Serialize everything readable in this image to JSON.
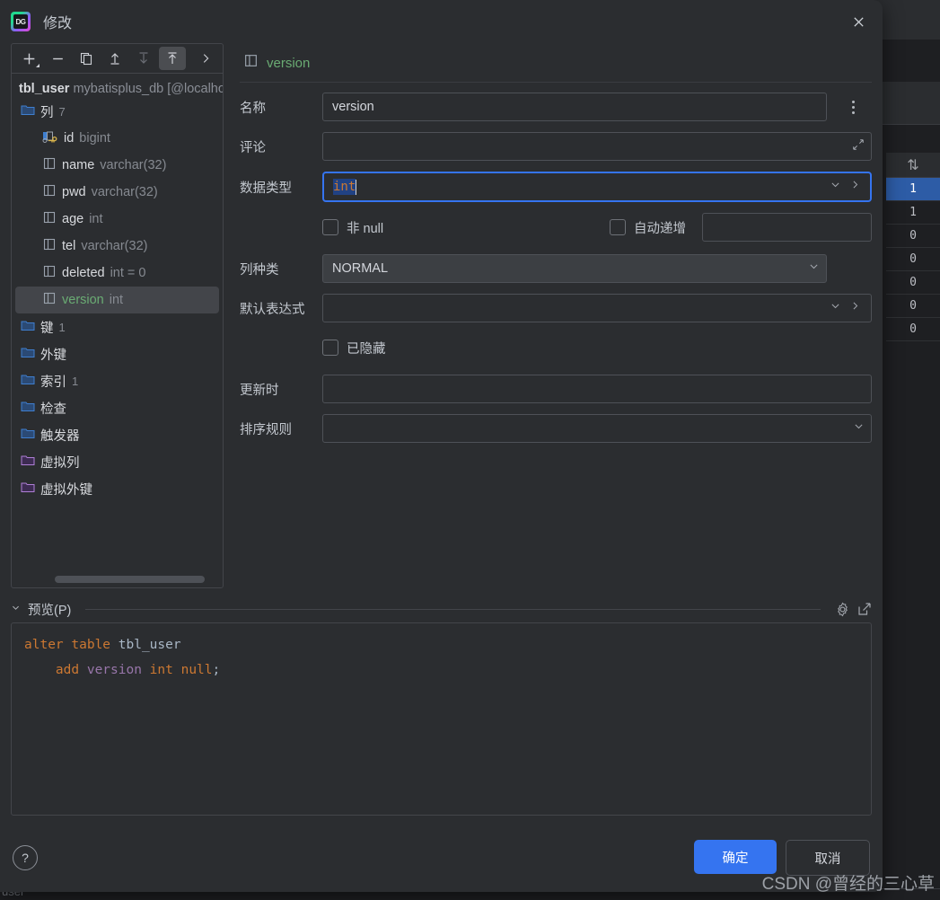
{
  "window": {
    "app_icon": "datagrip-logo-icon",
    "title": "修改",
    "close_icon": "close-icon"
  },
  "background": {
    "grid_header_icon": "sort-icon",
    "grid_values": [
      "1",
      "1",
      "0",
      "0",
      "0",
      "0",
      "0"
    ],
    "bottom_text": "user"
  },
  "tree": {
    "toolbar": [
      {
        "name": "add-button",
        "icon": "plus-icon",
        "state": "normal"
      },
      {
        "name": "remove-button",
        "icon": "minus-icon",
        "state": "normal"
      },
      {
        "name": "duplicate-button",
        "icon": "copy-icon",
        "state": "normal"
      },
      {
        "name": "move-up-button",
        "icon": "arrow-up-icon",
        "state": "normal"
      },
      {
        "name": "move-down-button",
        "icon": "arrow-down-icon",
        "state": "disabled"
      },
      {
        "name": "move-to-top-button",
        "icon": "arrow-up-to-line-icon",
        "state": "active"
      },
      {
        "name": "more-button",
        "icon": "chevron-right-icon",
        "state": "normal"
      }
    ],
    "header": {
      "table": "tbl_user",
      "source": "mybatisplus_db [@localhos"
    },
    "nodes": [
      {
        "icon": "folder-blue-icon",
        "label": "列",
        "count": "7",
        "type": "group"
      },
      {
        "icon": "primary-key-icon",
        "label": "id",
        "type_text": "bigint",
        "type": "column"
      },
      {
        "icon": "column-icon",
        "label": "name",
        "type_text": "varchar(32)",
        "type": "column"
      },
      {
        "icon": "column-icon",
        "label": "pwd",
        "type_text": "varchar(32)",
        "type": "column"
      },
      {
        "icon": "column-icon",
        "label": "age",
        "type_text": "int",
        "type": "column"
      },
      {
        "icon": "column-icon",
        "label": "tel",
        "type_text": "varchar(32)",
        "type": "column"
      },
      {
        "icon": "column-icon",
        "label": "deleted",
        "type_text": "int = 0",
        "type": "column"
      },
      {
        "icon": "column-icon",
        "label": "version",
        "type_text": "int",
        "type": "column",
        "selected": true
      },
      {
        "icon": "folder-blue-icon",
        "label": "键",
        "count": "1",
        "type": "group"
      },
      {
        "icon": "folder-blue-icon",
        "label": "外键",
        "count": "",
        "type": "group"
      },
      {
        "icon": "folder-blue-icon",
        "label": "索引",
        "count": "1",
        "type": "group"
      },
      {
        "icon": "folder-blue-icon",
        "label": "检查",
        "count": "",
        "type": "group"
      },
      {
        "icon": "folder-blue-icon",
        "label": "触发器",
        "count": "",
        "type": "group"
      },
      {
        "icon": "folder-purple-icon",
        "label": "虚拟列",
        "count": "",
        "type": "group"
      },
      {
        "icon": "folder-purple-icon",
        "label": "虚拟外键",
        "count": "",
        "type": "group"
      }
    ]
  },
  "form": {
    "header_icon": "column-icon",
    "header_name": "version",
    "fields": {
      "name_label": "名称",
      "name_value": "version",
      "name_more_icon": "kebab-menu-icon",
      "comment_label": "评论",
      "comment_value": "",
      "comment_expand_icon": "expand-icon",
      "datatype_label": "数据类型",
      "datatype_value": "int",
      "datatype_dropdown_icon": "chevron-down-icon",
      "datatype_browse_icon": "chevron-right-icon",
      "not_null_label": "非 null",
      "not_null_checked": false,
      "auto_increment_label": "自动递增",
      "auto_increment_checked": false,
      "auto_increment_value": "",
      "column_kind_label": "列种类",
      "column_kind_value": "NORMAL",
      "column_kind_icon": "chevron-down-icon",
      "default_expr_label": "默认表达式",
      "default_expr_value": "",
      "default_expr_dropdown_icon": "chevron-down-icon",
      "default_expr_browse_icon": "chevron-right-icon",
      "hidden_label": "已隐藏",
      "hidden_checked": false,
      "on_update_label": "更新时",
      "on_update_value": "",
      "collation_label": "排序规则",
      "collation_value": "",
      "collation_icon": "chevron-down-icon"
    }
  },
  "preview": {
    "caret_icon": "chevron-down-icon",
    "title": "预览(P)",
    "settings_icon": "gear-icon",
    "open_external_icon": "open-in-new-icon",
    "sql_lines": [
      [
        {
          "t": "alter table ",
          "c": "kw"
        },
        {
          "t": "tbl_user",
          "c": "idn"
        }
      ],
      [
        {
          "t": "    add ",
          "c": "kw"
        },
        {
          "t": "version",
          "c": "col"
        },
        {
          "t": " int null",
          "c": "kw"
        },
        {
          "t": ";",
          "c": "pn"
        }
      ]
    ]
  },
  "footer": {
    "help_icon": "help-icon",
    "help_label": "?",
    "ok_label": "确定",
    "cancel_label": "取消"
  },
  "watermark": "CSDN @曾经的三心草",
  "colors": {
    "accent": "#3574f0",
    "dialog_bg": "#2b2d30",
    "ide_bg": "#1e1f22",
    "green_text": "#6aab73",
    "orange_kw": "#cc7832",
    "purple_col": "#9876aa"
  }
}
